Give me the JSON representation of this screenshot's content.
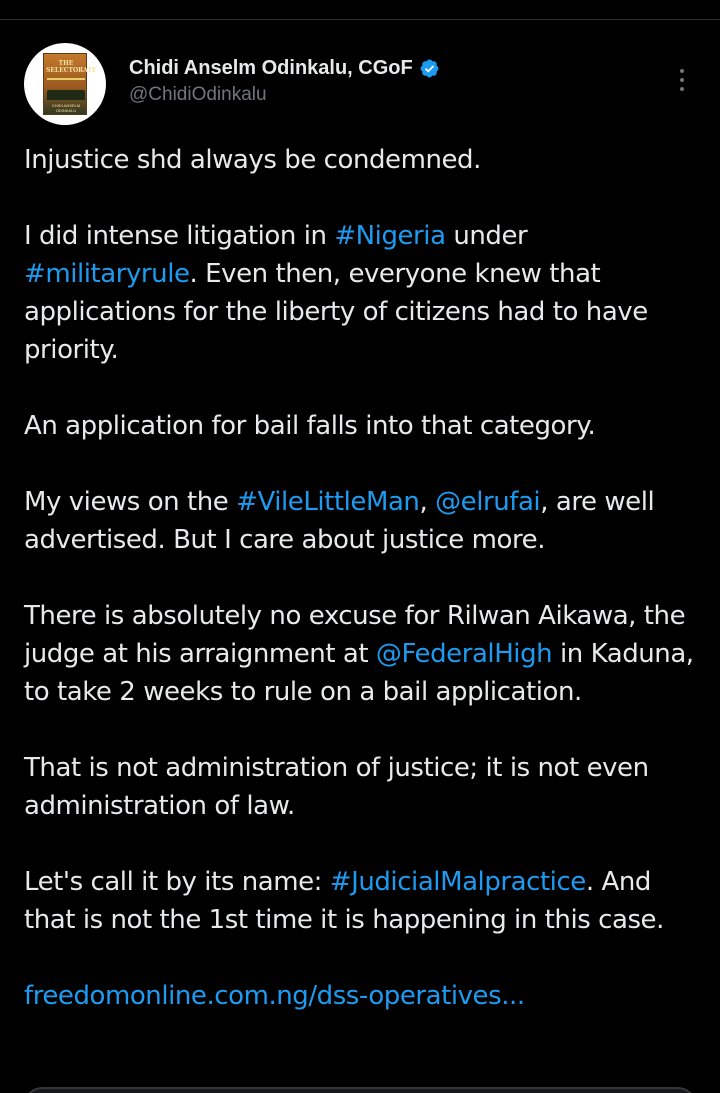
{
  "author": {
    "display_name": "Chidi Anselm Odinkalu, CGoF",
    "handle": "@ChidiOdinkalu",
    "verified": true,
    "avatar_book_title": "THE SELECTORATE",
    "avatar_book_author": "CHIDI ANSELM ODINKALU",
    "verified_color": "#1d9bf0"
  },
  "tweet": {
    "p1": "Injustice shd always be condemned.",
    "p2_a": "I did intense litigation in ",
    "p2_tag1": "#Nigeria",
    "p2_b": " under ",
    "p2_tag2": "#militaryrule",
    "p2_c": ". Even then, everyone knew that applications for the liberty of citizens had to have priority.",
    "p3": "An application for bail falls into that category.",
    "p4_a": "My views on the ",
    "p4_tag": "#VileLittleMan",
    "p4_b": ", ",
    "p4_mention": "@elrufai",
    "p4_c": ", are well advertised. But I care about justice more.",
    "p5_a": "There is absolutely no excuse for Rilwan Aikawa, the judge at his arraignment at ",
    "p5_mention": "@FederalHigh",
    "p5_b": " in Kaduna, to take 2 weeks to rule on a bail application.",
    "p6": "That is not administration of justice; it is not even administration of law.",
    "p7_a": "Let's call it by its name: ",
    "p7_tag": "#JudicialMalpractice",
    "p7_b": ". And that is not the 1st time it is happening in this case.",
    "link": "freedomonline.com.ng/dss-operatives..."
  },
  "colors": {
    "background": "#000000",
    "text": "#e7e9ea",
    "secondary": "#71767b",
    "link": "#1d9bf0"
  }
}
